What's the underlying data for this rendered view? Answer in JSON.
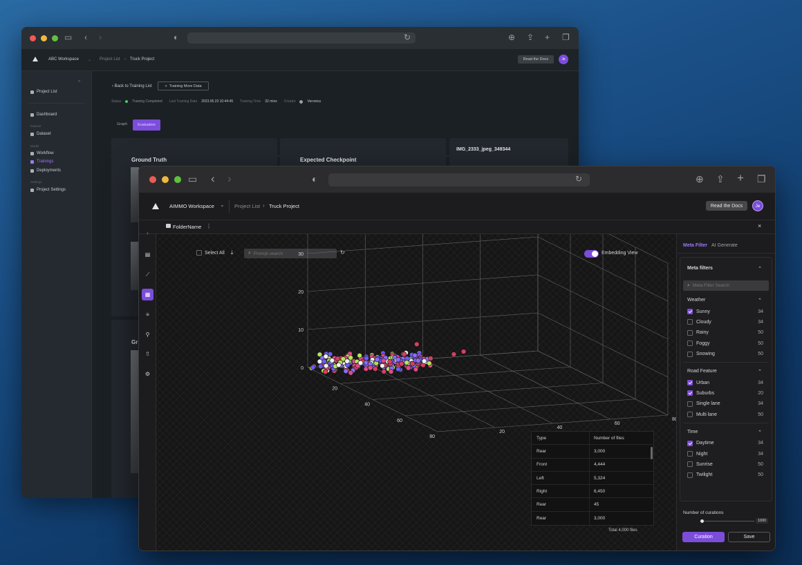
{
  "back_window": {
    "header": {
      "workspace": "ABC Workspace",
      "breadcrumb_parent": "Project List",
      "breadcrumb_current": "Truck Project",
      "docs_button": "Read the Docs",
      "avatar": "Je"
    },
    "sidebar": {
      "project_list": "Project List",
      "dashboard": "Dashboard",
      "section_dataset": "Dataset",
      "dataset": "Dataset",
      "section_model": "Model",
      "workflow": "Workflow",
      "trainings": "Trainings",
      "deployments": "Deployments",
      "section_settings": "Settings",
      "project_settings": "Project Settings"
    },
    "toolbar": {
      "back_link": "Back to Training List",
      "train_more": "Training More Data"
    },
    "status_bar": {
      "status_label": "Status",
      "status_value": "Training Completed",
      "last_date_label": "Last Training Date",
      "last_date_value": "2023.05.23 10:44:45",
      "time_label": "Training Time",
      "time_value": "32 mins",
      "creator_label": "Creator",
      "creator_value": "Veronica"
    },
    "tabs": {
      "graph": "Graph",
      "evaluation": "Evaluation"
    },
    "cards": {
      "ground_truth": "Ground Truth",
      "expected_checkpoint": "Expected Checkpoint",
      "image_name": "IMG_2333_jpeg_349344",
      "ground_truth_2": "Gr"
    }
  },
  "front_window": {
    "header": {
      "workspace": "AIMMO Workspace",
      "breadcrumb_parent": "Project List",
      "breadcrumb_current": "Truck Project",
      "docs_button": "Read the Docs",
      "avatar": "Je"
    },
    "folder": {
      "name": "FolderName"
    },
    "toolbar": {
      "select_all": "Select All",
      "search_placeholder": "Prompt search",
      "embedding_view": "Embedding View",
      "embedding_on": true
    },
    "axes": {
      "z_ticks": [
        "40",
        "30",
        "20",
        "10",
        "0"
      ],
      "x_ticks": [
        "20",
        "40",
        "60",
        "80"
      ],
      "y_ticks": [
        "80",
        "60",
        "40",
        "20"
      ]
    },
    "table": {
      "headers": [
        "Type",
        "Number of files"
      ],
      "rows": [
        [
          "Rear",
          "3,000"
        ],
        [
          "Front",
          "4,444"
        ],
        [
          "Left",
          "5,324"
        ],
        [
          "Right",
          "6,450"
        ],
        [
          "Rear",
          "45"
        ],
        [
          "Rear",
          "3,000"
        ]
      ],
      "total": "Total 4,000 files"
    },
    "right_panel": {
      "tab_meta": "Meta Filter",
      "tab_ai": "AI Generate",
      "section_title": "Meta filters",
      "search_placeholder": "Meta Filter Search",
      "groups": [
        {
          "title": "Weather",
          "items": [
            {
              "label": "Sunny",
              "count": "34",
              "checked": true
            },
            {
              "label": "Cloudy",
              "count": "34",
              "checked": false
            },
            {
              "label": "Rainy",
              "count": "50",
              "checked": false
            },
            {
              "label": "Foggy",
              "count": "50",
              "checked": false
            },
            {
              "label": "Snowing",
              "count": "50",
              "checked": false
            }
          ]
        },
        {
          "title": "Road Feature",
          "items": [
            {
              "label": "Urban",
              "count": "34",
              "checked": true
            },
            {
              "label": "Suburbs",
              "count": "20",
              "checked": true
            },
            {
              "label": "Single lane",
              "count": "34",
              "checked": false
            },
            {
              "label": "Multi lane",
              "count": "50",
              "checked": false
            }
          ]
        },
        {
          "title": "Time",
          "items": [
            {
              "label": "Daytime",
              "count": "34",
              "checked": true
            },
            {
              "label": "Night",
              "count": "34",
              "checked": false
            },
            {
              "label": "Sunrise",
              "count": "50",
              "checked": false
            },
            {
              "label": "Twilight",
              "count": "50",
              "checked": false
            }
          ]
        }
      ],
      "curations_label": "Number of curations",
      "curations_max": "1000",
      "curations_value": 0,
      "curation_button": "Curation",
      "save_button": "Save"
    },
    "colors": {
      "accent": "#7c4ddb",
      "points": [
        "#6a5cf0",
        "#e24a8a",
        "#f0f0f0",
        "#b6e35a",
        "#d64060",
        "#8a6cf7"
      ]
    }
  }
}
